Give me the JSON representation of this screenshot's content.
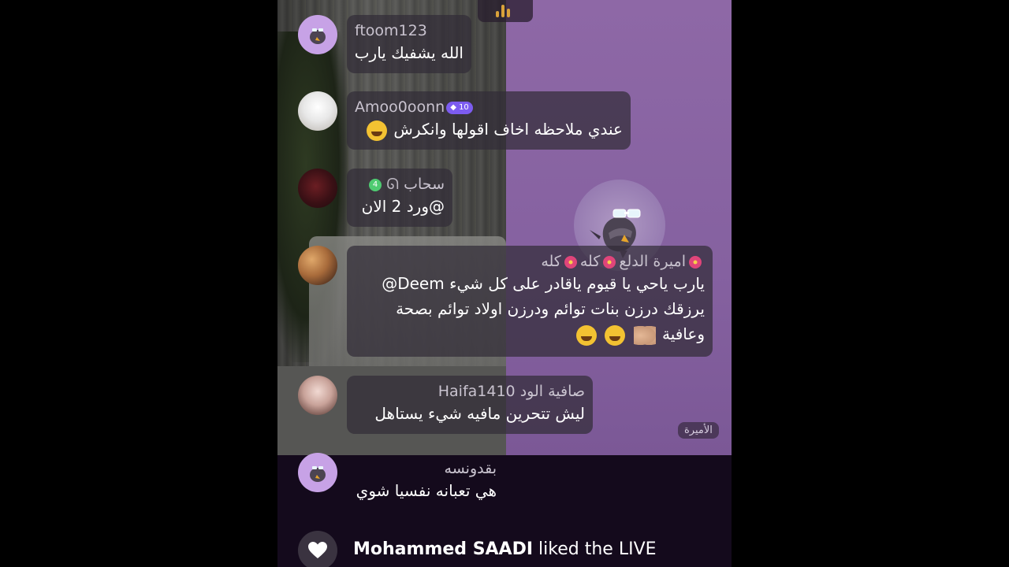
{
  "host": {
    "label": "الأميرة"
  },
  "comments": [
    {
      "username": "ftoom123",
      "message": "الله يشفيك يارب"
    },
    {
      "username": "Amoo0oonn",
      "badge": "10",
      "message": "عندي ملاحظه اخاف اقولها وانكرش",
      "emoji": "sweat-smile-emoji"
    },
    {
      "username": "سحاب",
      "badge": "4",
      "message": "@ورد 2 الان"
    },
    {
      "username": "اميرة الدلع 🌺 كله 🌺 كله",
      "username_parts": [
        "اميرة الدلع",
        "كله",
        "كله"
      ],
      "message_lines": [
        "يارب ياحي يا قيوم ياقادر على كل شيء Deem@",
        "يرزقك درزن بنات توائم ودرزن اولاد توائم بصحة",
        "وعافية"
      ]
    },
    {
      "username": "Haifa1410",
      "username_suffix": "صافية الود",
      "message": "ليش تتحرين مافيه شيء يستاهل"
    },
    {
      "username": "بقدونسه",
      "message": "هي تعبانه نفسيا شوي"
    }
  ],
  "like": {
    "user": "Mohammed SAADI",
    "text": "liked the LIVE"
  },
  "colors": {
    "purple_bg": "#8e68a6",
    "bubble_bg": "#322d37",
    "badge_purple": "#7c5cf0",
    "badge_green": "#4ecb71"
  }
}
